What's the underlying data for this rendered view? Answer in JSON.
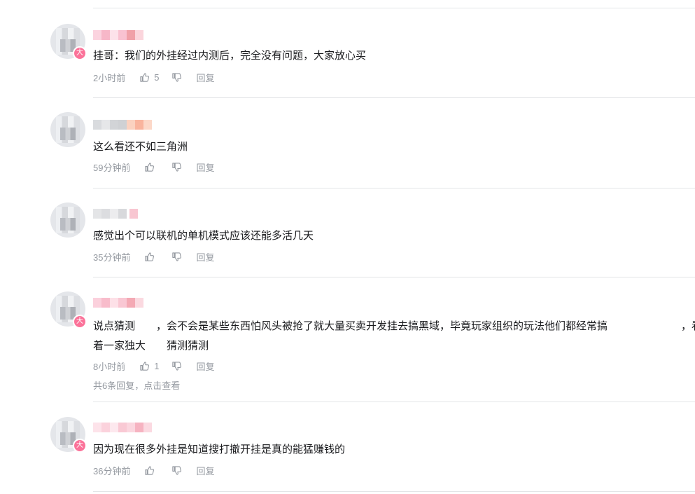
{
  "comments": [
    {
      "badge": "大",
      "text": "挂哥：我们的外挂经过内测后，完全没有问题，大家放心买",
      "time": "2小时前",
      "likes": "5",
      "reply_label": "回复"
    },
    {
      "badge": "",
      "text": "这么看还不如三角洲",
      "time": "59分钟前",
      "likes": "",
      "reply_label": "回复"
    },
    {
      "badge": "",
      "text": "感觉出个可以联机的单机模式应该还能多活几天",
      "time": "35分钟前",
      "likes": "",
      "reply_label": "回复"
    },
    {
      "badge": "大",
      "text_line1": "说点猜测　　，会不会是某些东西怕风头被抢了就大量买卖开发挂去搞黑域，毕竟玩家组织的玩法他们都经常搞　　　　　　　，看",
      "text_line2": "着一家独大　　猜测猜测",
      "time": "8小时前",
      "likes": "1",
      "reply_label": "回复",
      "sub_replies": "共6条回复，点击查看"
    },
    {
      "badge": "大",
      "text": "因为现在很多外挂是知道搜打撤开挂是真的能猛赚钱的",
      "time": "36分钟前",
      "likes": "",
      "reply_label": "回复"
    }
  ],
  "colors": {
    "text": "#18191c",
    "meta": "#9499a0",
    "divider": "#e3e5e7",
    "badge": "#fb7299"
  }
}
